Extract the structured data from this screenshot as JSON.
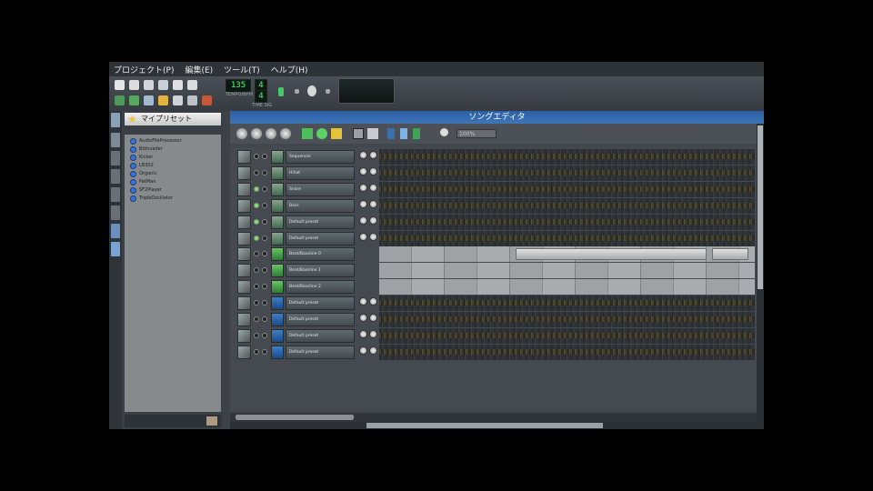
{
  "menu": [
    "プロジェクト(P)",
    "編集(E)",
    "ツール(T)",
    "ヘルプ(H)"
  ],
  "toolbar": {
    "tempo_value": "135",
    "tempo_label": "TEMPO/BPM",
    "timesig_top": "4",
    "timesig_bottom": "4",
    "timesig_label": "TIME SIG"
  },
  "presets": {
    "title": "マイプリセット",
    "items": [
      "AudioFileProcessor",
      "BitInvader",
      "Kicker",
      "LB302",
      "Organic",
      "PatMan",
      "SF2Player",
      "TripleOscillator"
    ]
  },
  "song_editor": {
    "title": "ソングエディタ",
    "zoom": "100%"
  },
  "tracks": [
    {
      "name": "Sequencer",
      "type": "inst",
      "mute_on": false
    },
    {
      "name": "Hihat",
      "type": "inst",
      "mute_on": false
    },
    {
      "name": "Snare",
      "type": "inst",
      "mute_on": true
    },
    {
      "name": "Bass",
      "type": "inst",
      "mute_on": true
    },
    {
      "name": "Default preset",
      "type": "inst",
      "mute_on": true
    },
    {
      "name": "Default preset",
      "type": "inst",
      "mute_on": true
    },
    {
      "name": "Beat/Bassline 0",
      "type": "bb",
      "mute_on": false
    },
    {
      "name": "Beat/Bassline 1",
      "type": "bb",
      "mute_on": false
    },
    {
      "name": "Beat/Bassline 2",
      "type": "bb",
      "mute_on": false
    },
    {
      "name": "Default preset",
      "type": "piano",
      "mute_on": false
    },
    {
      "name": "Default preset",
      "type": "piano",
      "mute_on": false
    },
    {
      "name": "Default preset",
      "type": "piano",
      "mute_on": false
    },
    {
      "name": "Default preset",
      "type": "piano",
      "mute_on": false
    }
  ],
  "icons": [
    "star-icon",
    "play-icon",
    "stop-icon",
    "record-icon",
    "zoom-icon",
    "new-file-icon",
    "open-icon",
    "save-icon"
  ]
}
